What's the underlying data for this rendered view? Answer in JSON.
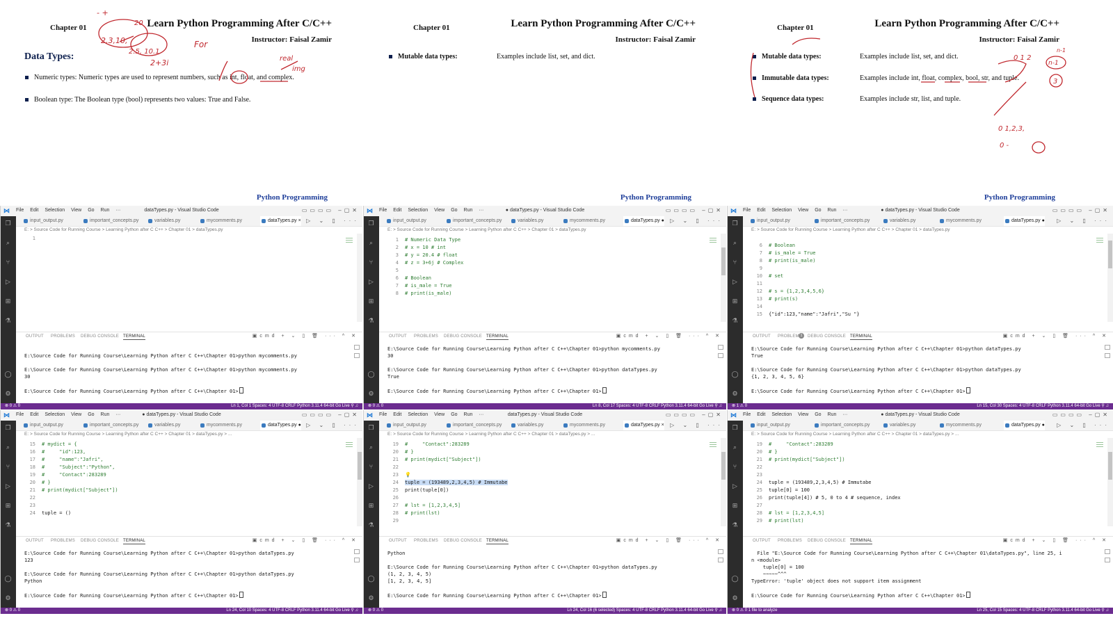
{
  "slides": [
    {
      "chapter": "Chapter 01",
      "title": "Learn Python Programming After C/C++",
      "instructor": "Instructor: Faisal Zamir",
      "heading": "Data Types:",
      "footer": "Python Programming",
      "bullets": [
        {
          "text": "Numeric types: Numeric types are used to represent numbers, such as int, float, and complex."
        },
        {
          "text": "Boolean type: The Boolean type (bool) represents two values: True and False."
        }
      ]
    },
    {
      "chapter": "Chapter 01",
      "title": "Learn Python Programming After C/C++",
      "instructor": "Instructor: Faisal Zamir",
      "footer": "Python Programming",
      "rows": [
        {
          "label": "Mutable data types:",
          "desc": "Examples include list, set, and dict."
        }
      ]
    },
    {
      "chapter": "Chapter 01",
      "title": "Learn Python Programming After C/C++",
      "instructor": "Instructor: Faisal Zamir",
      "footer": "Python Programming",
      "rows": [
        {
          "label": "Mutable data types:",
          "desc": "Examples include list, set, and dict."
        },
        {
          "label": "Immutable data types:",
          "desc": "Examples include int, float, complex, bool, str, and tuple."
        },
        {
          "label": "Sequence data types:",
          "desc": "Examples include str, list, and tuple."
        }
      ]
    }
  ],
  "vscode_common": {
    "menu": [
      "File",
      "Edit",
      "Selection",
      "View",
      "Go",
      "Run",
      "···"
    ],
    "tabs": [
      "input_output.py",
      "important_concepts.py",
      "variables.py",
      "mycomments.py",
      "dataTypes.py"
    ],
    "breadcrumb": "E: > Source Code for Running Course > Learning Python after C C++ > Chapter 01 > dataTypes.py",
    "panel_tabs": [
      "OUTPUT",
      "PROBLEMS",
      "DEBUG CONSOLE",
      "TERMINAL"
    ],
    "terminal_shell": "cmd",
    "status_right": "Spaces: 4   UTF-8   CRLF   Python   3.11.4 64-bit   Go Live"
  },
  "windows": [
    {
      "title": "dataTypes.py - Visual Studio Code",
      "active_tab_mark": "×",
      "breadcrumb_suffix": "",
      "code": [
        {
          "n": "1",
          "t": "",
          "c": "cd"
        }
      ],
      "terminal": [
        "",
        "E:\\Source Code for Running Course\\Learning Python after C C++\\Chapter 01>python mycomments.py",
        "",
        "E:\\Source Code for Running Course\\Learning Python after C C++\\Chapter 01>python mycomments.py",
        "30",
        "",
        "E:\\Source Code for Running Course\\Learning Python after C C++\\Chapter 01>"
      ],
      "status_left": "⊗ 0 ⚠ 0",
      "status_pos": "Ln 1, Col 1"
    },
    {
      "title": "● dataTypes.py - Visual Studio Code",
      "active_tab_mark": "●",
      "breadcrumb_suffix": "",
      "code": [
        {
          "n": "1",
          "t": "# Numeric Data Type",
          "c": "cm"
        },
        {
          "n": "2",
          "t": "# x = 10 # int",
          "c": "cm"
        },
        {
          "n": "3",
          "t": "# y = 20.4 # float",
          "c": "cm"
        },
        {
          "n": "4",
          "t": "# z = 3+6j # Complex",
          "c": "cm"
        },
        {
          "n": "5",
          "t": "",
          "c": "cd"
        },
        {
          "n": "6",
          "t": "# Boolean",
          "c": "cm"
        },
        {
          "n": "7",
          "t": "# is_male = True",
          "c": "cm"
        },
        {
          "n": "8",
          "t": "# print(is_male)",
          "c": "cm"
        }
      ],
      "terminal": [
        "E:\\Source Code for Running Course\\Learning Python after C C++\\Chapter 01>python mycomments.py",
        "30",
        "",
        "E:\\Source Code for Running Course\\Learning Python after C C++\\Chapter 01>python dataTypes.py",
        "True",
        "",
        "E:\\Source Code for Running Course\\Learning Python after C C++\\Chapter 01>"
      ],
      "status_left": "⊗ 0 ⚠ 0",
      "status_pos": "Ln 8, Col 17"
    },
    {
      "title": "● dataTypes.py - Visual Studio Code",
      "active_tab_mark": "●",
      "breadcrumb_suffix": "",
      "code": [
        {
          "n": "6",
          "t": "# Boolean",
          "c": "cm"
        },
        {
          "n": "7",
          "t": "# is_male = True",
          "c": "cm"
        },
        {
          "n": "8",
          "t": "# print(is_male)",
          "c": "cm"
        },
        {
          "n": "9",
          "t": "",
          "c": "cd"
        },
        {
          "n": "10",
          "t": "# set",
          "c": "cm"
        },
        {
          "n": "11",
          "t": "",
          "c": "cd"
        },
        {
          "n": "12",
          "t": "# s = {1,2,3,4,5,6}",
          "c": "cm"
        },
        {
          "n": "13",
          "t": "# print(s)",
          "c": "cm"
        },
        {
          "n": "14",
          "t": "",
          "c": "cd"
        },
        {
          "n": "15",
          "t": "{\"id\":123,\"name\":\"Jafri\",\"Su \"}",
          "c": "cd"
        }
      ],
      "problems_badge": "1",
      "terminal": [
        "E:\\Source Code for Running Course\\Learning Python after C C++\\Chapter 01>python dataTypes.py",
        "True",
        "",
        "E:\\Source Code for Running Course\\Learning Python after C C++\\Chapter 01>python dataTypes.py",
        "{1, 2, 3, 4, 5, 6}",
        "",
        "E:\\Source Code for Running Course\\Learning Python after C C++\\Chapter 01>"
      ],
      "status_left": "⊗ 1 ⚠ 0",
      "status_pos": "Ln 15, Col 30"
    },
    {
      "title": "● dataTypes.py - Visual Studio Code",
      "active_tab_mark": "●",
      "breadcrumb_suffix": " > ...",
      "code": [
        {
          "n": "15",
          "t": "# mydict = {",
          "c": "cm"
        },
        {
          "n": "16",
          "t": "#     \"id\":123,",
          "c": "cm"
        },
        {
          "n": "17",
          "t": "#     \"name\":\"Jafri\",",
          "c": "cm"
        },
        {
          "n": "18",
          "t": "#     \"Subject\":\"Python\",",
          "c": "cm"
        },
        {
          "n": "19",
          "t": "#     \"Contact\":283289",
          "c": "cm"
        },
        {
          "n": "20",
          "t": "# }",
          "c": "cm"
        },
        {
          "n": "21",
          "t": "# print(mydict[\"Subject\"])",
          "c": "cm"
        },
        {
          "n": "22",
          "t": "",
          "c": "cd"
        },
        {
          "n": "23",
          "t": "",
          "c": "cd"
        },
        {
          "n": "24",
          "t": "tuple = ()",
          "c": "cd"
        }
      ],
      "terminal": [
        "E:\\Source Code for Running Course\\Learning Python after C C++\\Chapter 01>python dataTypes.py",
        "123",
        "",
        "E:\\Source Code for Running Course\\Learning Python after C C++\\Chapter 01>python dataTypes.py",
        "Python",
        "",
        "E:\\Source Code for Running Course\\Learning Python after C C++\\Chapter 01>"
      ],
      "status_left": "⊗ 0 ⚠ 0",
      "status_pos": "Ln 24, Col 10"
    },
    {
      "title": "dataTypes.py - Visual Studio Code",
      "active_tab_mark": "×",
      "breadcrumb_suffix": " > ...",
      "code": [
        {
          "n": "19",
          "t": "#     \"Contact\":283289",
          "c": "cm"
        },
        {
          "n": "20",
          "t": "# }",
          "c": "cm"
        },
        {
          "n": "21",
          "t": "# print(mydict[\"Subject\"])",
          "c": "cm"
        },
        {
          "n": "22",
          "t": "",
          "c": "cd"
        },
        {
          "n": "23",
          "t": "💡",
          "c": "cd"
        },
        {
          "n": "24",
          "t": "tuple = (193489,2,3,4,5) # Immutabe",
          "c": "cd"
        },
        {
          "n": "25",
          "t": "print(tuple[0])",
          "c": "cd"
        },
        {
          "n": "26",
          "t": "",
          "c": "cd"
        },
        {
          "n": "27",
          "t": "# lst = [1,2,3,4,5]",
          "c": "cm"
        },
        {
          "n": "28",
          "t": "# print(lst)",
          "c": "cm"
        },
        {
          "n": "29",
          "t": "",
          "c": "cd"
        }
      ],
      "terminal": [
        "Python",
        "",
        "E:\\Source Code for Running Course\\Learning Python after C C++\\Chapter 01>python dataTypes.py",
        "(1, 2, 3, 4, 5)",
        "[1, 2, 3, 4, 5]",
        "",
        "E:\\Source Code for Running Course\\Learning Python after C C++\\Chapter 01>"
      ],
      "status_left": "⊗ 0 ⚠ 0",
      "status_pos": "Ln 24, Col 16 (6 selected)"
    },
    {
      "title": "● dataTypes.py - Visual Studio Code",
      "active_tab_mark": "●",
      "breadcrumb_suffix": " > ...",
      "code": [
        {
          "n": "19",
          "t": "#     \"Contact\":283289",
          "c": "cm"
        },
        {
          "n": "20",
          "t": "# }",
          "c": "cm"
        },
        {
          "n": "21",
          "t": "# print(mydict[\"Subject\"])",
          "c": "cm"
        },
        {
          "n": "22",
          "t": "",
          "c": "cd"
        },
        {
          "n": "23",
          "t": "",
          "c": "cd"
        },
        {
          "n": "24",
          "t": "tuple = (193489,2,3,4,5) # Immutabe",
          "c": "cd"
        },
        {
          "n": "25",
          "t": "tuple[0] = 100",
          "c": "cd"
        },
        {
          "n": "26",
          "t": "print(tuple[4]) # 5, 0 to 4 # sequence, index",
          "c": "cd"
        },
        {
          "n": "27",
          "t": "",
          "c": "cd"
        },
        {
          "n": "28",
          "t": "# lst = [1,2,3,4,5]",
          "c": "cm"
        },
        {
          "n": "29",
          "t": "# print(lst)",
          "c": "cm"
        }
      ],
      "terminal": [
        "  File \"E:\\Source Code for Running Course\\Learning Python after C C++\\Chapter 01\\dataTypes.py\", line 25, i",
        "n <module>",
        "    tuple[0] = 100",
        "    ~~~~~^^^",
        "TypeError: 'tuple' object does not support item assignment",
        "",
        "E:\\Source Code for Running Course\\Learning Python after C C++\\Chapter 01>"
      ],
      "status_left": "⊗ 0 ⚠ 0   1 file to analyze",
      "status_pos": "Ln 25, Col 15"
    }
  ],
  "ink_notes": {
    "slide1": [
      "- +",
      "20",
      "2,3,10,",
      "2.5, 10.1",
      "2+3i",
      "For",
      "real",
      "img"
    ],
    "slide3": [
      "0 1 2",
      "n-1",
      "n-1",
      "3",
      "0 1,2,3,",
      "0 -"
    ]
  },
  "colors": {
    "status_bar": "#6b2c8f",
    "comment": "#2e7d32",
    "ink": "#c0272d",
    "slide_heading": "#0d1f4d",
    "slide_footer": "#1f3f9a"
  }
}
